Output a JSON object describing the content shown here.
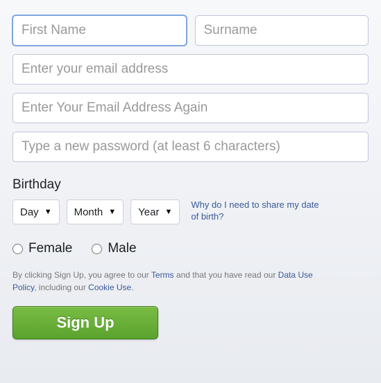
{
  "form": {
    "first_name_placeholder": "First Name",
    "surname_placeholder": "Surname",
    "email_placeholder": "Enter your email address",
    "email_confirm_placeholder": "Enter Your Email Address Again",
    "password_placeholder": "Type a new password (at least 6 characters)"
  },
  "birthday": {
    "label": "Birthday",
    "day_label": "Day",
    "month_label": "Month",
    "year_label": "Year",
    "hint": "Why do I need to share my date of birth?"
  },
  "gender": {
    "female": "Female",
    "male": "Male"
  },
  "legal": {
    "prefix": "By clicking Sign Up, you agree to our ",
    "terms": "Terms",
    "mid1": " and that you have read our ",
    "data_policy": "Data Use Policy",
    "mid2": ", including our ",
    "cookie": "Cookie Use",
    "suffix": "."
  },
  "signup_button": "Sign Up"
}
